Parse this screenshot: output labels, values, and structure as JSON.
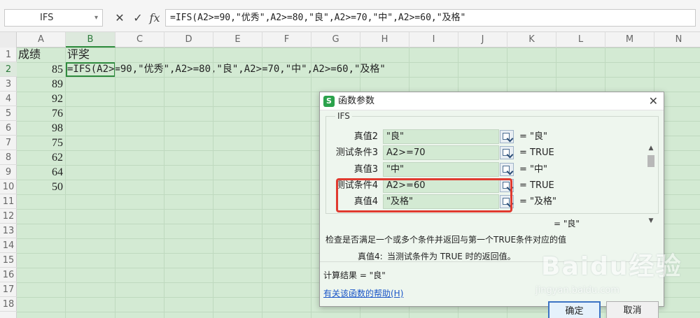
{
  "formula_bar": {
    "name_box": "IFS",
    "cancel_glyph": "✕",
    "confirm_glyph": "✓",
    "fx_label": "fx",
    "formula": "=IFS(A2>=90,\"优秀\",A2>=80,\"良\",A2>=70,\"中\",A2>=60,\"及格\""
  },
  "columns": [
    "A",
    "B",
    "C",
    "D",
    "E",
    "F",
    "G",
    "H",
    "I",
    "J",
    "K",
    "L",
    "M",
    "N"
  ],
  "rows": [
    "1",
    "2",
    "3",
    "4",
    "5",
    "6",
    "7",
    "8",
    "9",
    "10",
    "11",
    "12",
    "13",
    "14",
    "15",
    "16",
    "17",
    "18"
  ],
  "cells": {
    "A1": "成绩",
    "B1": "评奖",
    "B2": "=IFS(A2>=90,\"优秀\",A2>=80,\"良\",A2>=70,\"中\",A2>=60,\"及格\"",
    "scores": [
      "85",
      "89",
      "92",
      "76",
      "98",
      "75",
      "62",
      "64",
      "50"
    ]
  },
  "dialog": {
    "title": "函数参数",
    "logo": "S",
    "close": "✕",
    "function_name": "IFS",
    "args": [
      {
        "label": "真值2",
        "value": "\"良\"",
        "result": "= \"良\""
      },
      {
        "label": "测试条件3",
        "value": "A2>=70",
        "result": "= TRUE"
      },
      {
        "label": "真值3",
        "value": "\"中\"",
        "result": "= \"中\""
      },
      {
        "label": "测试条件4",
        "value": "A2>=60",
        "result": "= TRUE"
      },
      {
        "label": "真值4",
        "value": "\"及格\"",
        "result": "= \"及格\""
      }
    ],
    "overall_result": "= \"良\"",
    "description": "检查是否满足一个或多个条件并返回与第一个TRUE条件对应的值",
    "arg_help_label": "真值4:",
    "arg_help_text": "当测试条件为 TRUE 时的返回值。",
    "calc_result": "计算结果 = \"良\"",
    "help_link": "有关该函数的帮助(H)",
    "ok": "确定",
    "cancel": "取消"
  },
  "watermark": {
    "text": "Baidu经验",
    "url": "jingyan.baidu.com"
  },
  "colors": {
    "sheet_bg": "#d3ead3",
    "accent": "#2e8b3d",
    "highlight": "#e03a2f"
  }
}
